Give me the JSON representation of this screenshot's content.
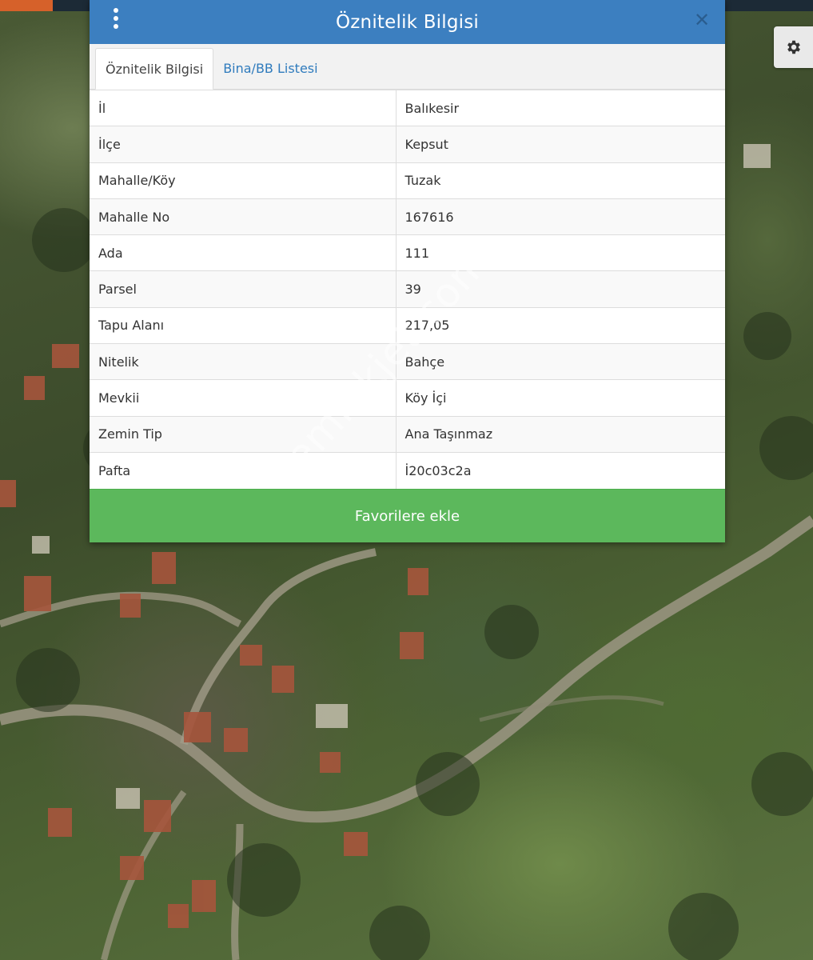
{
  "dialog": {
    "title": "Öznitelik Bilgisi",
    "tabs": [
      {
        "label": "Öznitelik Bilgisi",
        "active": true
      },
      {
        "label": "Bina/BB Listesi",
        "active": false
      }
    ],
    "rows": [
      {
        "label": "İl",
        "value": "Balıkesir"
      },
      {
        "label": "İlçe",
        "value": "Kepsut"
      },
      {
        "label": "Mahalle/Köy",
        "value": "Tuzak"
      },
      {
        "label": "Mahalle No",
        "value": "167616"
      },
      {
        "label": "Ada",
        "value": "111"
      },
      {
        "label": "Parsel",
        "value": "39"
      },
      {
        "label": "Tapu Alanı",
        "value": "217,05"
      },
      {
        "label": "Nitelik",
        "value": "Bahçe"
      },
      {
        "label": "Mevkii",
        "value": "Köy İçi"
      },
      {
        "label": "Zemin Tip",
        "value": "Ana Taşınmaz"
      },
      {
        "label": "Pafta",
        "value": "İ20c03c2a"
      }
    ],
    "favorite_label": "Favorilere ekle"
  },
  "watermark": "emlakjet.com",
  "icons": {
    "menu": "vertical-dots-icon",
    "close": "close-icon",
    "settings": "gear-icon"
  },
  "colors": {
    "header": "#3c7fc0",
    "favorite_button": "#5cb85c",
    "tab_link": "#2f7bbd",
    "top_accent": "#d6612a"
  }
}
